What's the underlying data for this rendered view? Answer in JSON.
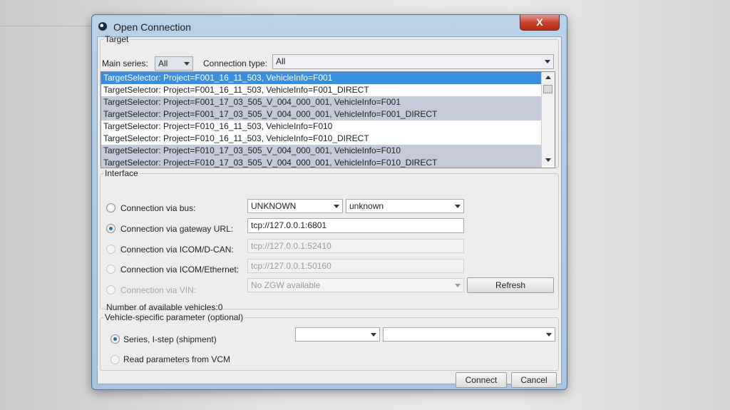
{
  "window": {
    "title": "Open Connection",
    "close_label": "X"
  },
  "target": {
    "legend": "Target",
    "main_series_label": "Main series:",
    "main_series_value": "All",
    "connection_type_label": "Connection type:",
    "connection_type_value": "All",
    "items": [
      "TargetSelector: Project=F001_16_11_503, VehicleInfo=F001",
      "TargetSelector: Project=F001_16_11_503, VehicleInfo=F001_DIRECT",
      "TargetSelector: Project=F001_17_03_505_V_004_000_001, VehicleInfo=F001",
      "TargetSelector: Project=F001_17_03_505_V_004_000_001, VehicleInfo=F001_DIRECT",
      "TargetSelector: Project=F010_16_11_503, VehicleInfo=F010",
      "TargetSelector: Project=F010_16_11_503, VehicleInfo=F010_DIRECT",
      "TargetSelector: Project=F010_17_03_505_V_004_000_001, VehicleInfo=F010",
      "TargetSelector: Project=F010_17_03_505_V_004_000_001, VehicleInfo=F010_DIRECT"
    ]
  },
  "interface": {
    "legend": "Interface",
    "bus_label": "Connection via bus:",
    "bus_combo1": "UNKNOWN",
    "bus_combo2": "unknown",
    "gateway_label": "Connection via gateway URL:",
    "gateway_value": "tcp://127.0.0.1:6801",
    "icom_dcan_label": "Connection via ICOM/D-CAN:",
    "icom_dcan_value": "tcp://127.0.0.1:52410",
    "icom_eth_label": "Connection via ICOM/Ethernet:",
    "icom_eth_value": "tcp://127.0.0.1:50160",
    "vin_label": "Connection via VIN:",
    "vin_value": "No ZGW available",
    "refresh_label": "Refresh",
    "available_label": "Number of available vehicles:0"
  },
  "vehicle_param": {
    "legend": "Vehicle-specific parameter (optional)",
    "series_label": "Series, I-step (shipment)",
    "series_combo": "",
    "istep_combo": "",
    "vcm_label": "Read parameters from VCM"
  },
  "buttons": {
    "connect": "Connect",
    "cancel": "Cancel"
  }
}
